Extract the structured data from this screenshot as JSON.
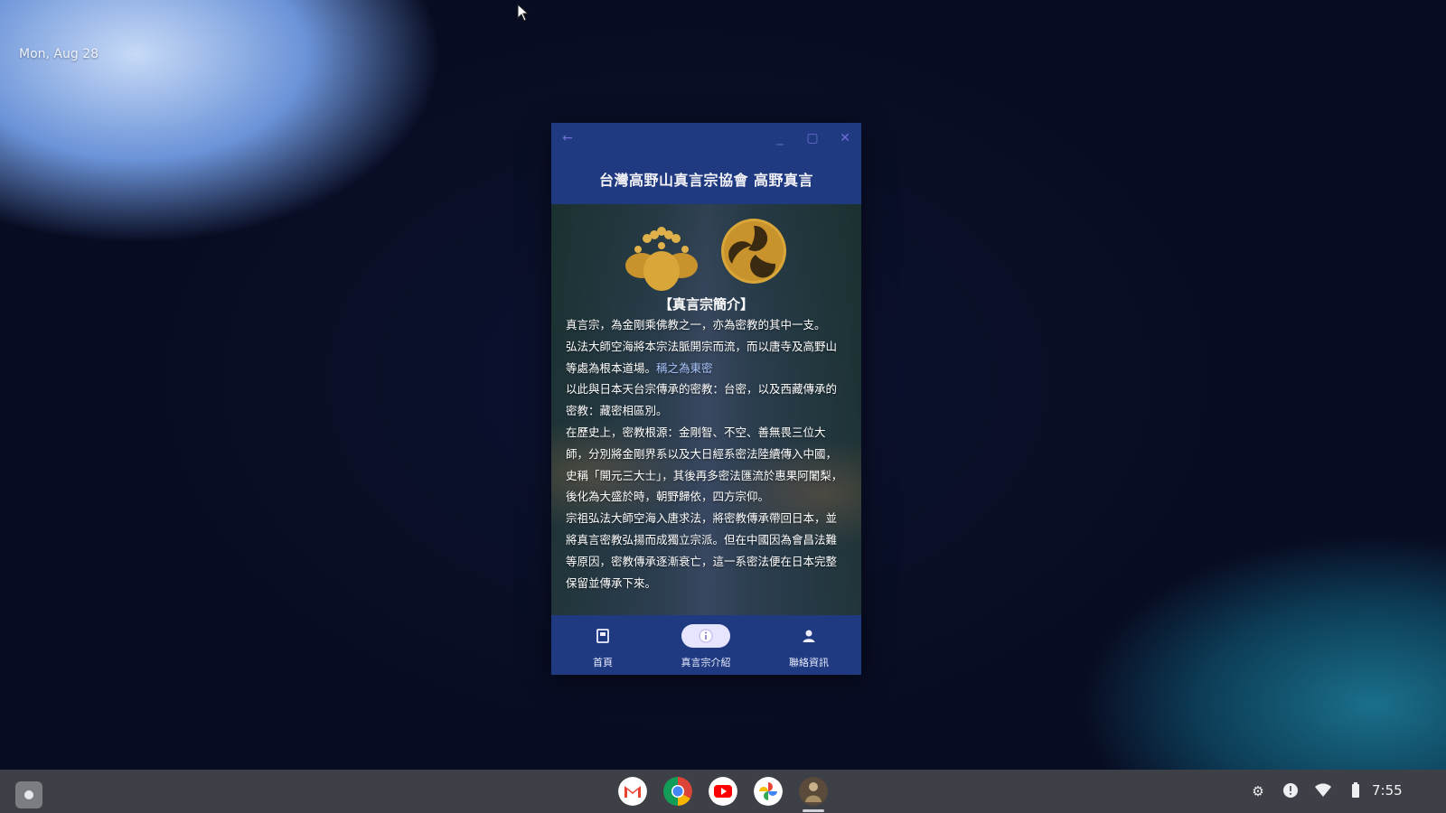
{
  "desktop": {
    "date": "Mon, Aug 28"
  },
  "window": {
    "back_icon": "arrow-left-icon",
    "minimize_icon": "minimize-icon",
    "maximize_icon": "maximize-icon",
    "close_icon": "close-icon",
    "title": "台灣高野山真言宗協會 高野真言"
  },
  "content": {
    "section_title": "【真言宗簡介】",
    "paragraphs": [
      "真言宗，為金剛乘佛教之一，亦為密教的其中一支。",
      "弘法大師空海將本宗法脈開宗而流，而以唐寺及高野山等處為根本道場。",
      "以此與日本天台宗傳承的密教：台密，以及西藏傳承的密教：藏密相區別。",
      "在歷史上，密教根源：金剛智、不空、善無畏三位大師，分別將金剛界系以及大日經系密法陸續傳入中國，史稱「開元三大士」，其後再多密法匯流於惠果阿闍梨，後化為大盛於時，朝野歸依，四方宗仰。",
      "宗祖弘法大師空海入唐求法，將密教傳承帶回日本，並將真言密教弘揚而成獨立宗派。但在中國因為會昌法難等原因，密教傳承逐漸衰亡，這一系密法便在日本完整保留並傳承下來。"
    ],
    "link_text": "稱之為東密"
  },
  "bottom_nav": {
    "items": [
      {
        "label": "首頁",
        "icon": "book-icon"
      },
      {
        "label": "真言宗介紹",
        "icon": "info-icon",
        "active": true
      },
      {
        "label": "聯絡資訊",
        "icon": "person-icon"
      }
    ]
  },
  "taskbar": {
    "apps": [
      "gmail-icon",
      "chrome-icon",
      "youtube-icon",
      "photos-icon",
      "shingon-app-icon"
    ],
    "tray": [
      "settings-icon",
      "notification-icon",
      "wifi-icon",
      "battery-icon"
    ],
    "time": "7:55"
  },
  "colors": {
    "window_bg": "#1f3a80",
    "active_nav": "#e7e4ff",
    "gold": "#d9a63a",
    "taskbar": "#3d4147"
  }
}
